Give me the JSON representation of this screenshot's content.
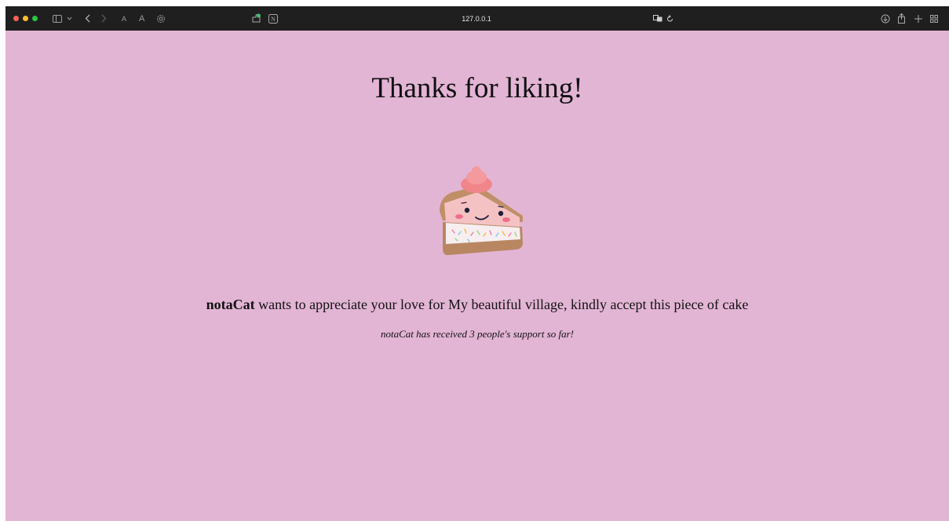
{
  "browser": {
    "url": "127.0.0.1",
    "colors": {
      "close": "#fe5f57",
      "minimize": "#febc2e",
      "zoom": "#28c840"
    },
    "icons": [
      "sidebar-icon",
      "chevron-down-icon",
      "back-icon",
      "forward-icon",
      "text-size-small-icon",
      "text-size-large-icon",
      "settings-icon",
      "extension-icon",
      "notion-icon",
      "translate-icon",
      "reload-icon",
      "download-icon",
      "share-icon",
      "new-tab-icon",
      "tab-overview-icon"
    ],
    "text_small_a": "A",
    "text_large_a": "A"
  },
  "page": {
    "title": "Thanks for liking!",
    "sender": "notaCat",
    "message_rest": " wants to appreciate your love for My beautiful village, kindly accept this piece of cake",
    "support_text": "notaCat has received 3 people's support so far!",
    "background": "#e3b5d5"
  }
}
